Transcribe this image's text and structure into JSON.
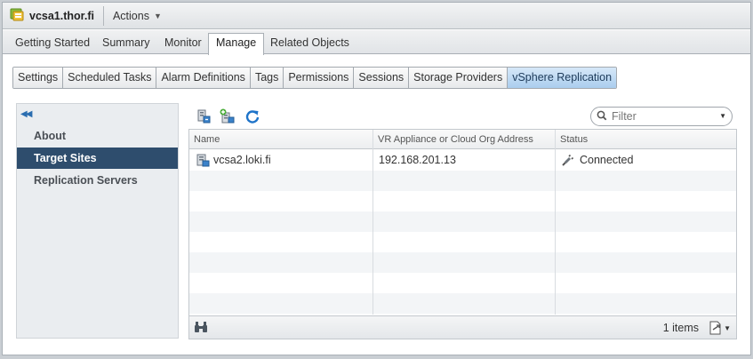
{
  "header": {
    "object_title": "vcsa1.thor.fi",
    "actions_label": "Actions"
  },
  "main_tabs": [
    {
      "label": "Getting Started"
    },
    {
      "label": "Summary"
    },
    {
      "label": "Monitor"
    },
    {
      "label": "Manage",
      "active": true
    },
    {
      "label": "Related Objects"
    }
  ],
  "sub_tabs": [
    {
      "label": "Settings"
    },
    {
      "label": "Scheduled Tasks"
    },
    {
      "label": "Alarm Definitions"
    },
    {
      "label": "Tags"
    },
    {
      "label": "Permissions"
    },
    {
      "label": "Sessions"
    },
    {
      "label": "Storage Providers"
    },
    {
      "label": "vSphere Replication",
      "active": true
    }
  ],
  "left_nav": {
    "items": [
      {
        "label": "About"
      },
      {
        "label": "Target Sites",
        "active": true
      },
      {
        "label": "Replication Servers"
      }
    ]
  },
  "toolbar": {
    "icons": [
      "connect-site-icon",
      "add-site-icon",
      "refresh-icon"
    ]
  },
  "filter": {
    "placeholder": "Filter"
  },
  "grid": {
    "columns": [
      "Name",
      "VR Appliance or Cloud Org Address",
      "Status"
    ],
    "rows": [
      {
        "name": "vcsa2.loki.fi",
        "address": "192.168.201.13",
        "status": "Connected"
      }
    ],
    "count_label": "1 items"
  },
  "colors": {
    "active_nav": "#2e4d6d",
    "active_subtab": "#aacdee",
    "refresh": "#1f74c9"
  }
}
